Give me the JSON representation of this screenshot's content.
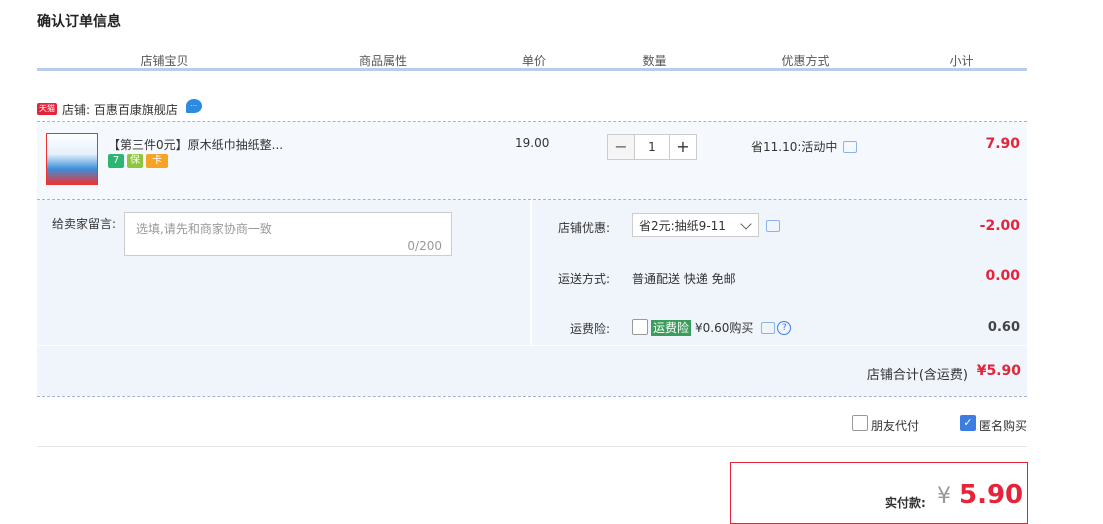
{
  "title": "确认订单信息",
  "columns": [
    "店铺宝贝",
    "商品属性",
    "单价",
    "数量",
    "优惠方式",
    "小计"
  ],
  "shop": {
    "tag": "天猫",
    "label": "店铺: 百惠百康旗舰店"
  },
  "item": {
    "name": "【第三件0元】原木纸巾抽纸整...",
    "price": "19.00",
    "quantity": "1",
    "minus": "−",
    "plus": "+",
    "discount": "省11.10:活动中",
    "subtotal": "7.90",
    "badges": [
      "7",
      "保",
      "卡"
    ]
  },
  "message": {
    "label": "给卖家留言:",
    "placeholder": "选填,请先和商家协商一致",
    "count": "0/200"
  },
  "shop_discount": {
    "label": "店铺优惠:",
    "selected": "省2元:抽纸9-11",
    "value": "-2.00"
  },
  "shipping": {
    "label": "运送方式:",
    "value_text": "普通配送 快递 免邮",
    "value": "0.00"
  },
  "insurance": {
    "label": "运费险:",
    "tag": "运费险",
    "price_text": "¥0.60购买",
    "value": "0.60",
    "help": "?"
  },
  "shop_total": {
    "label": "店铺合计(含运费)",
    "value": "¥5.90"
  },
  "options": {
    "friend_pay": "朋友代付",
    "anonymous": "匿名购买"
  },
  "payment": {
    "label": "实付款:",
    "currency": "¥",
    "value": "5.90"
  },
  "colors": {
    "accent": "#e4243b",
    "header_bar": "#b8ccec",
    "panel": "#f0f5fc"
  }
}
